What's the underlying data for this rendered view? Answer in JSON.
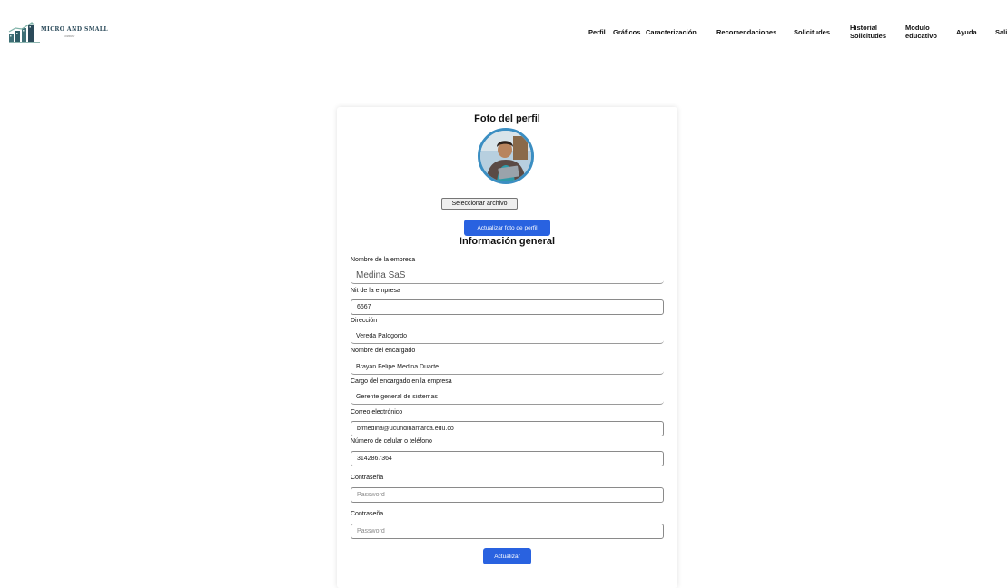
{
  "brand": {
    "title": "MICRO AND SMALL",
    "subtitle": "COMPANY",
    "logo_icon": "bar-chart-buildings-icon"
  },
  "nav": {
    "perfil": "Perfil",
    "graficos": "Gráficos",
    "caracterizacion": "Caracterización",
    "recomendaciones": "Recomendaciones",
    "solicitudes": "Solicitudes",
    "historial_line1": "Historial",
    "historial_line2": "Solicitudes",
    "modulo_line1": "Modulo",
    "modulo_line2": "educativo",
    "ayuda": "Ayuda",
    "salir": "Sali"
  },
  "photo_section": {
    "title": "Foto del perfil",
    "file_button": "Seleccionar archivo",
    "update_photo_button": "Actualizar foto de perfil"
  },
  "general_section": {
    "title": "Información general",
    "fields": {
      "company_name": {
        "label": "Nombre de la empresa",
        "value": "Medina SaS"
      },
      "nit": {
        "label": "Nit de la empresa",
        "value": "6667"
      },
      "address": {
        "label": "Dirección",
        "value": "Vereda Palogordo"
      },
      "manager_name": {
        "label": "Nombre del encargado",
        "value": "Brayan Felipe Medina Duarte"
      },
      "manager_role": {
        "label": "Cargo del encargado en la empresa",
        "value": "Gerente general de sistemas"
      },
      "email": {
        "label": "Correo electrónico",
        "value": "bfmedina@ucundinamarca.edu.co"
      },
      "phone": {
        "label": "Número de celular o teléfono",
        "value": "3142867364"
      },
      "password": {
        "label": "Contraseña",
        "placeholder": "Password"
      },
      "password_confirm": {
        "label": "Contraseña",
        "placeholder": "Password"
      }
    },
    "submit_button": "Actualizar"
  },
  "colors": {
    "accent_blue": "#2962e0",
    "avatar_ring": "#3b8ec2",
    "logo_teal": "#2b4a5a"
  }
}
